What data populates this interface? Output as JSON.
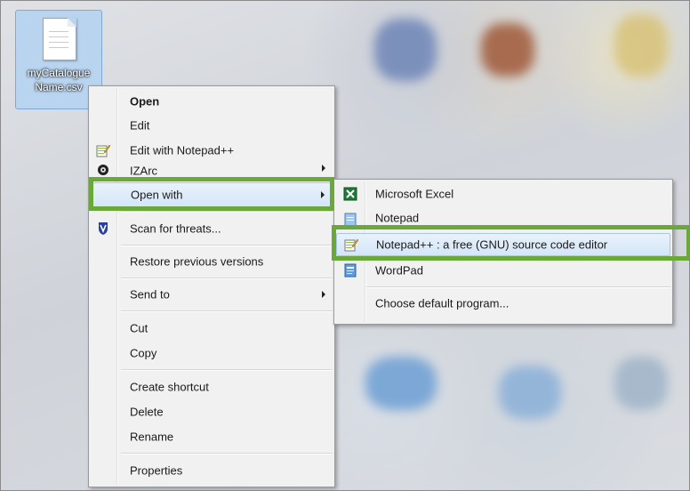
{
  "desktop_file": {
    "name": "myCatalogue Name.csv",
    "name_line1": "myCatalogue",
    "name_line2": "Name.csv"
  },
  "context_menu": {
    "items": [
      {
        "label": "Open",
        "bold": true
      },
      {
        "label": "Edit"
      },
      {
        "label": "Edit with Notepad++",
        "icon": "notepadpp-icon"
      },
      {
        "label": "IZArc",
        "icon": "izarc-icon",
        "submenu": true
      },
      {
        "label": "Open with",
        "submenu": true,
        "highlighted": true
      },
      {
        "label": "Scan for threats...",
        "icon": "shield-icon"
      },
      {
        "label": "Restore previous versions"
      },
      {
        "label": "Send to",
        "submenu": true
      },
      {
        "label": "Cut"
      },
      {
        "label": "Copy"
      },
      {
        "label": "Create shortcut"
      },
      {
        "label": "Delete"
      },
      {
        "label": "Rename"
      },
      {
        "label": "Properties"
      }
    ]
  },
  "open_with_submenu": {
    "items": [
      {
        "label": "Microsoft Excel",
        "icon": "excel-icon"
      },
      {
        "label": "Notepad",
        "icon": "notepad-icon"
      },
      {
        "label": "Notepad++ : a free (GNU) source code editor",
        "icon": "notepadpp-icon",
        "highlighted": true
      },
      {
        "label": "WordPad",
        "icon": "wordpad-icon"
      },
      {
        "label": "Choose default program..."
      }
    ]
  },
  "colors": {
    "highlight_box": "#6aa83a",
    "menu_bg": "#f1f1f1",
    "selection": "#d4e6f7"
  }
}
